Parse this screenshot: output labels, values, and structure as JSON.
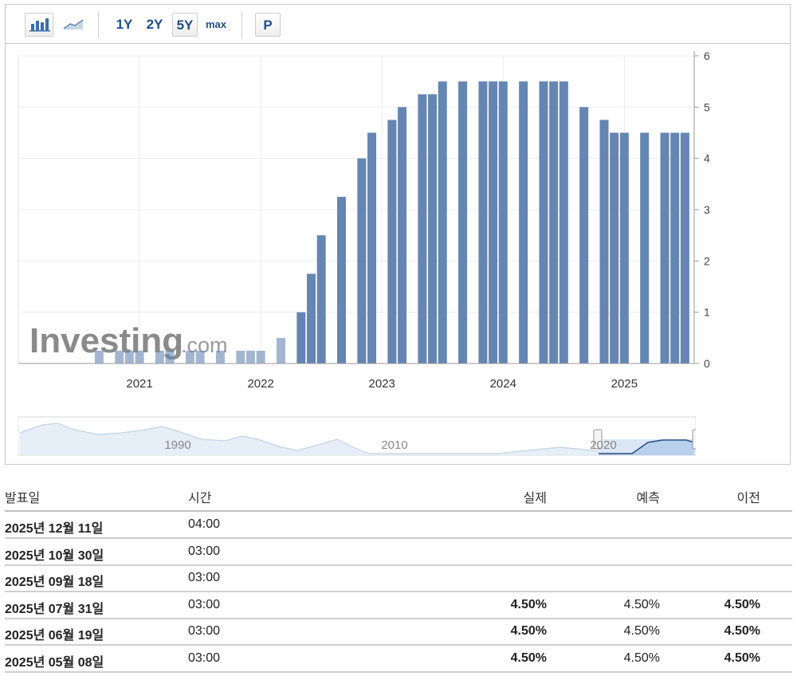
{
  "toolbar": {
    "ranges": [
      "1Y",
      "2Y",
      "5Y"
    ],
    "max_label": "max",
    "p_label": "P",
    "active_range": "5Y"
  },
  "chart_data": {
    "type": "bar",
    "title": "",
    "xlabel": "",
    "ylabel": "",
    "ylim": [
      0,
      6
    ],
    "y_ticks": [
      "0",
      "1",
      "2",
      "3",
      "4",
      "5",
      "6"
    ],
    "x_ticks": [
      "2021",
      "2022",
      "2023",
      "2024",
      "2025"
    ],
    "x": [
      "2020-09",
      "2020-11",
      "2020-12",
      "2021-01",
      "2021-03",
      "2021-04",
      "2021-06",
      "2021-07",
      "2021-09",
      "2021-11",
      "2021-12",
      "2022-01",
      "2022-03",
      "2022-05",
      "2022-06",
      "2022-07",
      "2022-09",
      "2022-11",
      "2022-12",
      "2023-02",
      "2023-03",
      "2023-05",
      "2023-06",
      "2023-07",
      "2023-09",
      "2023-11",
      "2023-12",
      "2024-01",
      "2024-03",
      "2024-05",
      "2024-06",
      "2024-07",
      "2024-09",
      "2024-11",
      "2024-12",
      "2025-01",
      "2025-03",
      "2025-05",
      "2025-06",
      "2025-07"
    ],
    "values": [
      0.25,
      0.25,
      0.25,
      0.25,
      0.25,
      0.25,
      0.25,
      0.25,
      0.25,
      0.25,
      0.25,
      0.25,
      0.5,
      1.0,
      1.75,
      2.5,
      3.25,
      4.0,
      4.5,
      4.75,
      5.0,
      5.25,
      5.25,
      5.5,
      5.5,
      5.5,
      5.5,
      5.5,
      5.5,
      5.5,
      5.5,
      5.5,
      5.0,
      4.75,
      4.5,
      4.5,
      4.5,
      4.5,
      4.5,
      4.5
    ],
    "bar_color": "#6585b3",
    "grid": true,
    "watermark": "Investing.com",
    "navigator_labels": [
      "1990",
      "2010",
      "2020"
    ]
  },
  "table": {
    "headers": {
      "date": "발표일",
      "time": "시간",
      "actual": "실제",
      "forecast": "예측",
      "previous": "이전"
    },
    "rows": [
      {
        "date": "2025년 12월 11일",
        "time": "04:00",
        "actual": "",
        "forecast": "",
        "previous": ""
      },
      {
        "date": "2025년 10월 30일",
        "time": "03:00",
        "actual": "",
        "forecast": "",
        "previous": ""
      },
      {
        "date": "2025년 09월 18일",
        "time": "03:00",
        "actual": "",
        "forecast": "",
        "previous": ""
      },
      {
        "date": "2025년 07월 31일",
        "time": "03:00",
        "actual": "4.50%",
        "forecast": "4.50%",
        "previous": "4.50%"
      },
      {
        "date": "2025년 06월 19일",
        "time": "03:00",
        "actual": "4.50%",
        "forecast": "4.50%",
        "previous": "4.50%"
      },
      {
        "date": "2025년 05월 08일",
        "time": "03:00",
        "actual": "4.50%",
        "forecast": "4.50%",
        "previous": "4.50%"
      }
    ]
  }
}
